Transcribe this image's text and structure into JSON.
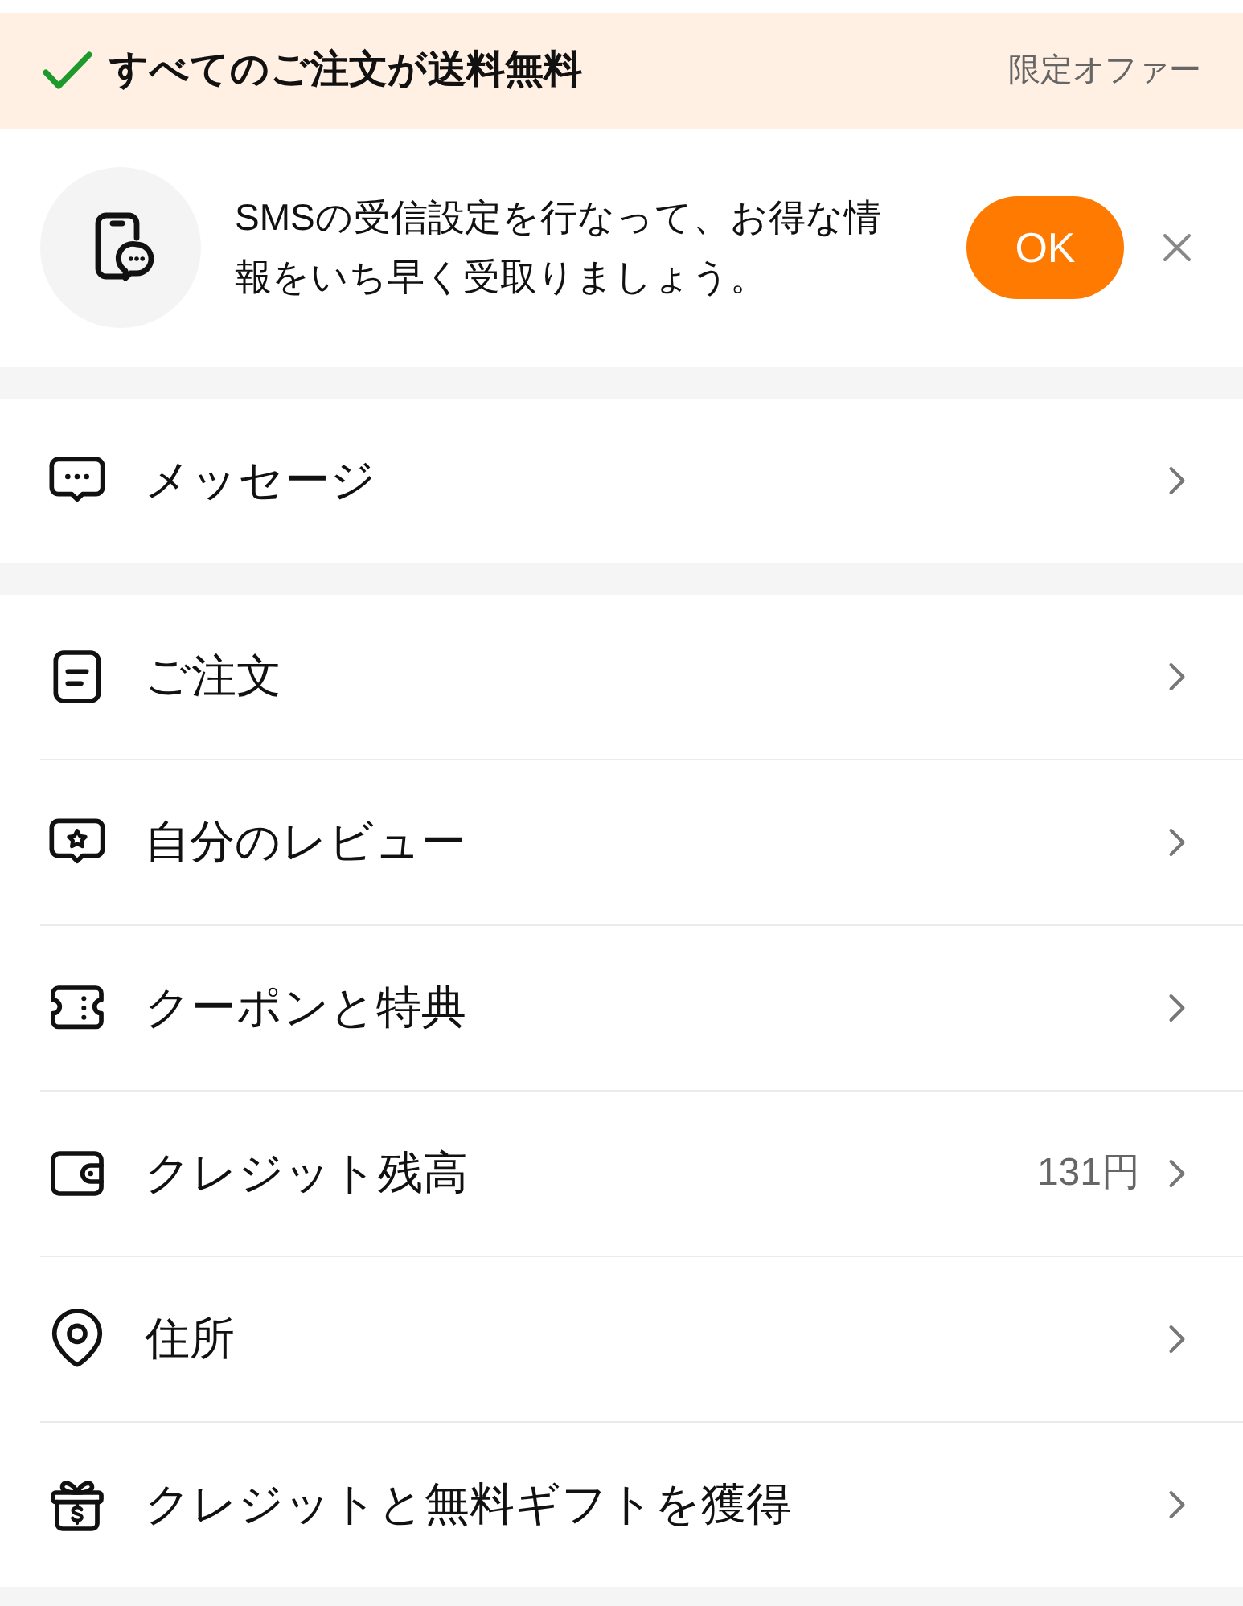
{
  "promo_banner": {
    "text": "すべてのご注文が送料無料",
    "tag": "限定オファー"
  },
  "sms_prompt": {
    "text": "SMSの受信設定を行なって、お得な情報をいち早く受取りましょう。",
    "button": "OK"
  },
  "sections": [
    {
      "items": [
        {
          "kind": "message",
          "label": "メッセージ"
        }
      ]
    },
    {
      "items": [
        {
          "kind": "order",
          "label": "ご注文"
        },
        {
          "kind": "review",
          "label": "自分のレビュー"
        },
        {
          "kind": "coupon",
          "label": "クーポンと特典"
        },
        {
          "kind": "wallet",
          "label": "クレジット残高",
          "value": "131円"
        },
        {
          "kind": "location",
          "label": "住所"
        },
        {
          "kind": "gift",
          "label": "クレジットと無料ギフトを獲得"
        }
      ]
    }
  ]
}
